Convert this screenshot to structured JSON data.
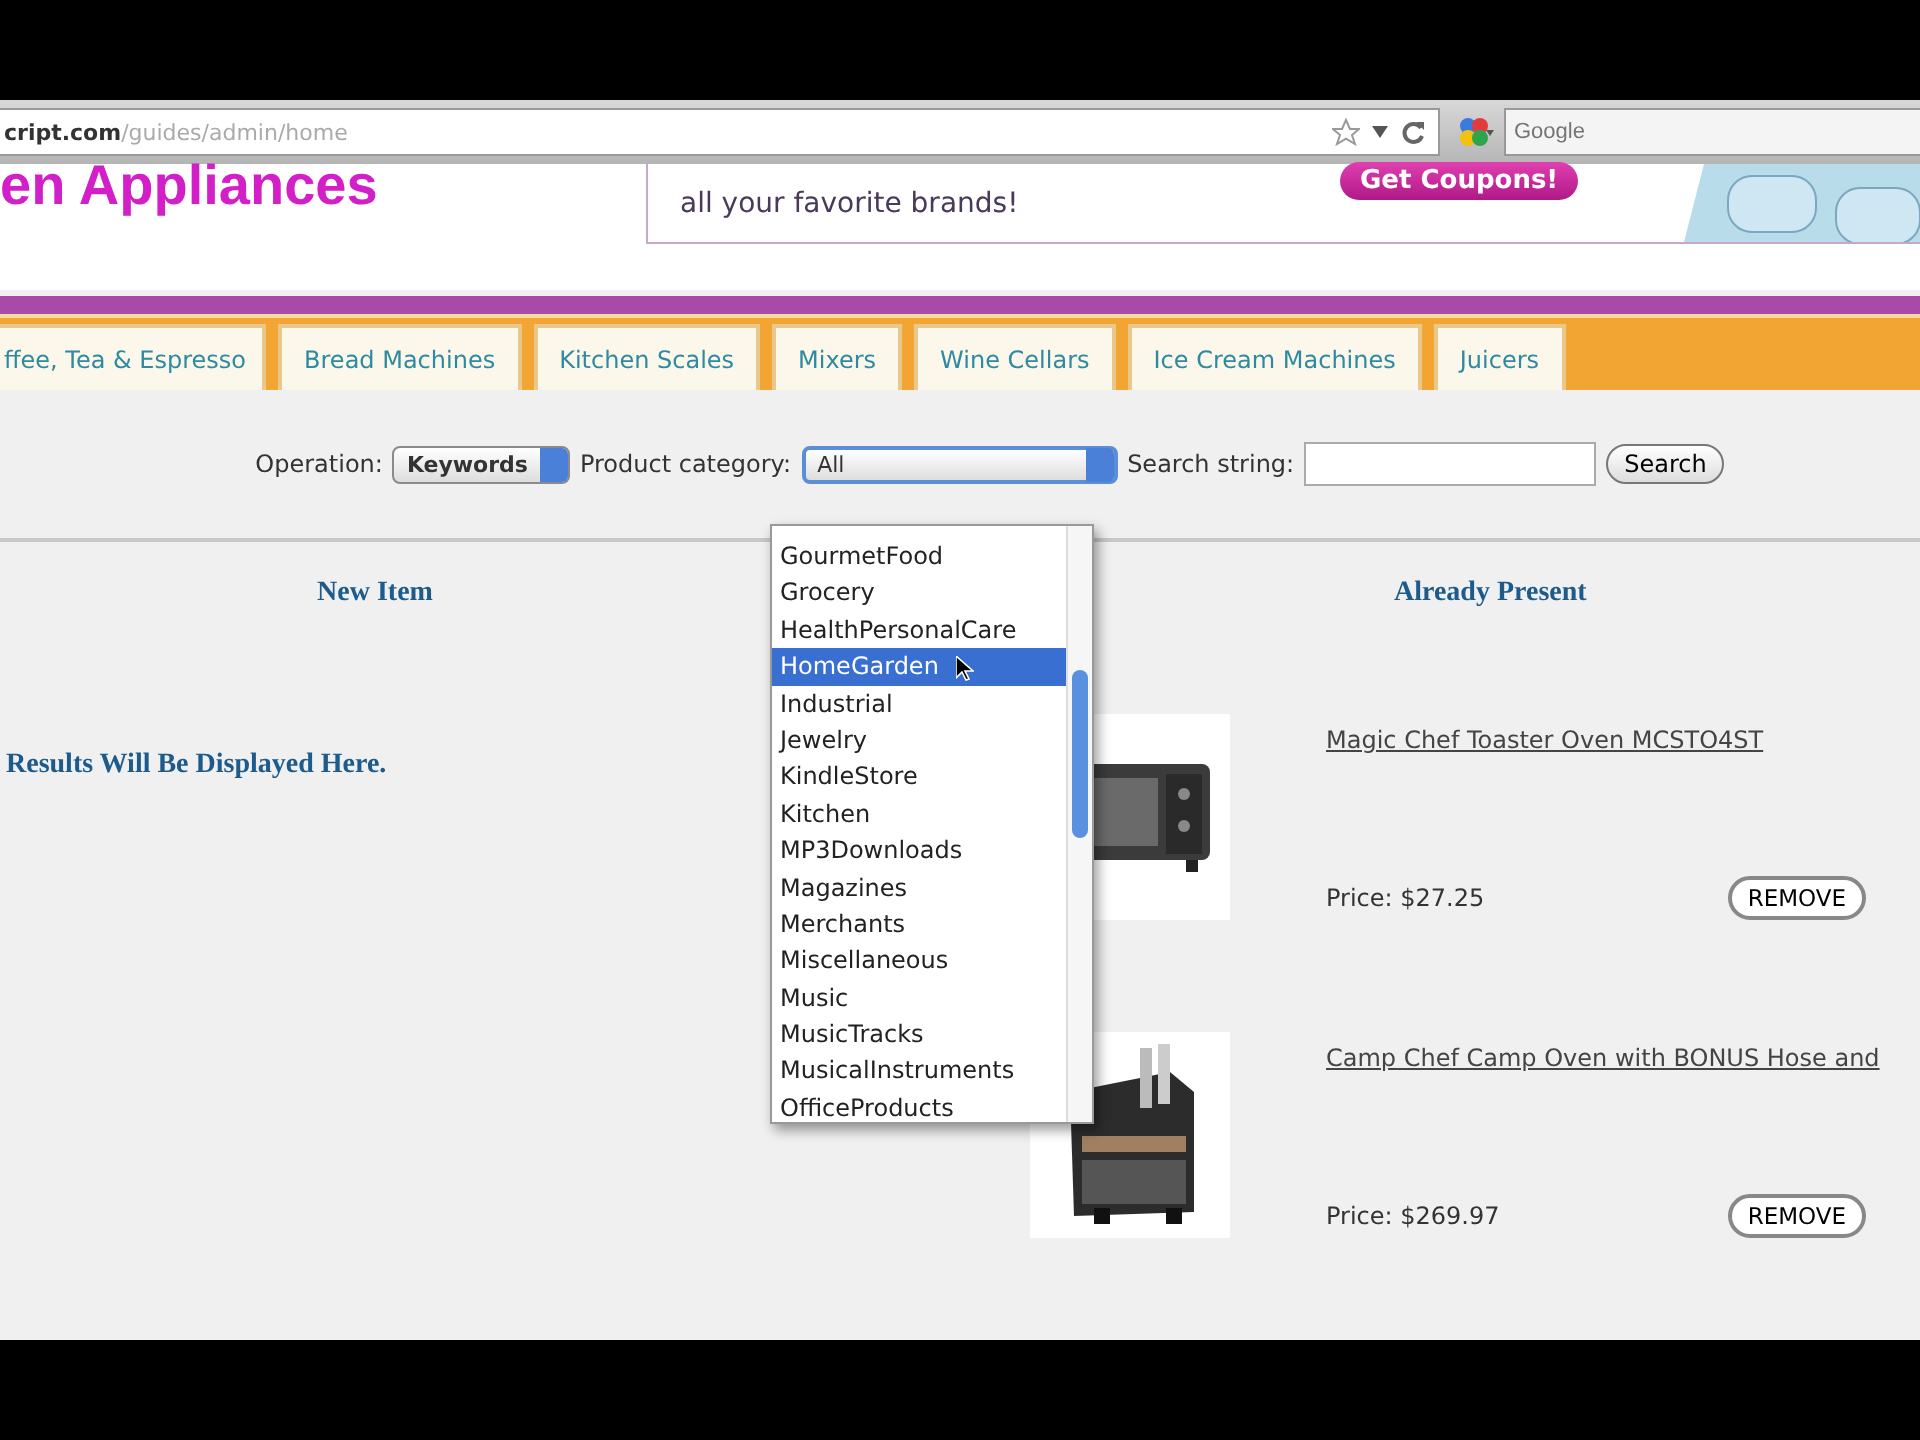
{
  "browser": {
    "address": "**cript.com**/guides/admin/home",
    "search_placeholder": "Google"
  },
  "header": {
    "title": "en Appliances",
    "ad_text": "all your favorite brands!",
    "ad_button": "Get Coupons!"
  },
  "tabs": [
    {
      "label": "ffee, Tea & Espresso"
    },
    {
      "label": "Bread Machines"
    },
    {
      "label": "Kitchen Scales"
    },
    {
      "label": "Mixers"
    },
    {
      "label": "Wine Cellars"
    },
    {
      "label": "Ice Cream Machines"
    },
    {
      "label": "Juicers"
    }
  ],
  "search_form": {
    "operation_label": "Operation:",
    "operation_value": "Keywords",
    "category_label": "Product category:",
    "category_value": "All",
    "search_label": "Search string:",
    "search_button": "Search"
  },
  "category_dropdown": {
    "items": [
      {
        "label": "GourmetFood",
        "selected": false
      },
      {
        "label": "Grocery",
        "selected": false
      },
      {
        "label": "HealthPersonalCare",
        "selected": false
      },
      {
        "label": "HomeGarden",
        "selected": true
      },
      {
        "label": "Industrial",
        "selected": false
      },
      {
        "label": "Jewelry",
        "selected": false
      },
      {
        "label": "KindleStore",
        "selected": false
      },
      {
        "label": "Kitchen",
        "selected": false
      },
      {
        "label": "MP3Downloads",
        "selected": false
      },
      {
        "label": "Magazines",
        "selected": false
      },
      {
        "label": "Merchants",
        "selected": false
      },
      {
        "label": "Miscellaneous",
        "selected": false
      },
      {
        "label": "Music",
        "selected": false
      },
      {
        "label": "MusicTracks",
        "selected": false
      },
      {
        "label": "MusicalInstruments",
        "selected": false
      },
      {
        "label": "OfficeProducts",
        "selected": false
      }
    ]
  },
  "new_item": {
    "heading": "New Item",
    "message": "Results Will Be Displayed Here."
  },
  "already_present": {
    "heading": "Already Present",
    "products": [
      {
        "title": "Magic Chef Toaster Oven MCSTO4ST",
        "price": "Price: $27.25",
        "button": "REMOVE"
      },
      {
        "title": "Camp Chef Camp Oven with BONUS Hose and",
        "price": "Price: $269.97",
        "button": "REMOVE"
      }
    ]
  }
}
